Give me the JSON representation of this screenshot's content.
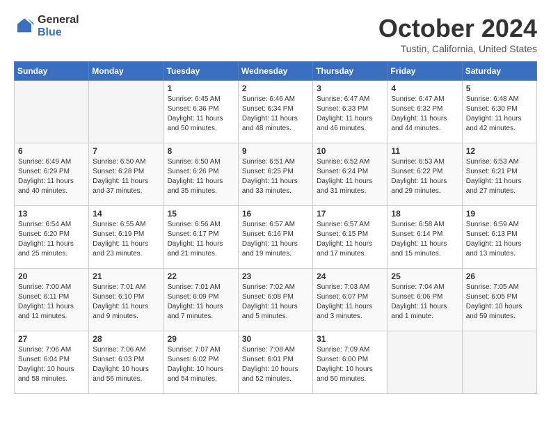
{
  "header": {
    "logo_line1": "General",
    "logo_line2": "Blue",
    "month_title": "October 2024",
    "location": "Tustin, California, United States"
  },
  "days_of_week": [
    "Sunday",
    "Monday",
    "Tuesday",
    "Wednesday",
    "Thursday",
    "Friday",
    "Saturday"
  ],
  "weeks": [
    [
      {
        "day": "",
        "sunrise": "",
        "sunset": "",
        "daylight": "",
        "empty": true
      },
      {
        "day": "",
        "sunrise": "",
        "sunset": "",
        "daylight": "",
        "empty": true
      },
      {
        "day": "1",
        "sunrise": "Sunrise: 6:45 AM",
        "sunset": "Sunset: 6:36 PM",
        "daylight": "Daylight: 11 hours and 50 minutes.",
        "empty": false
      },
      {
        "day": "2",
        "sunrise": "Sunrise: 6:46 AM",
        "sunset": "Sunset: 6:34 PM",
        "daylight": "Daylight: 11 hours and 48 minutes.",
        "empty": false
      },
      {
        "day": "3",
        "sunrise": "Sunrise: 6:47 AM",
        "sunset": "Sunset: 6:33 PM",
        "daylight": "Daylight: 11 hours and 46 minutes.",
        "empty": false
      },
      {
        "day": "4",
        "sunrise": "Sunrise: 6:47 AM",
        "sunset": "Sunset: 6:32 PM",
        "daylight": "Daylight: 11 hours and 44 minutes.",
        "empty": false
      },
      {
        "day": "5",
        "sunrise": "Sunrise: 6:48 AM",
        "sunset": "Sunset: 6:30 PM",
        "daylight": "Daylight: 11 hours and 42 minutes.",
        "empty": false
      }
    ],
    [
      {
        "day": "6",
        "sunrise": "Sunrise: 6:49 AM",
        "sunset": "Sunset: 6:29 PM",
        "daylight": "Daylight: 11 hours and 40 minutes.",
        "empty": false
      },
      {
        "day": "7",
        "sunrise": "Sunrise: 6:50 AM",
        "sunset": "Sunset: 6:28 PM",
        "daylight": "Daylight: 11 hours and 37 minutes.",
        "empty": false
      },
      {
        "day": "8",
        "sunrise": "Sunrise: 6:50 AM",
        "sunset": "Sunset: 6:26 PM",
        "daylight": "Daylight: 11 hours and 35 minutes.",
        "empty": false
      },
      {
        "day": "9",
        "sunrise": "Sunrise: 6:51 AM",
        "sunset": "Sunset: 6:25 PM",
        "daylight": "Daylight: 11 hours and 33 minutes.",
        "empty": false
      },
      {
        "day": "10",
        "sunrise": "Sunrise: 6:52 AM",
        "sunset": "Sunset: 6:24 PM",
        "daylight": "Daylight: 11 hours and 31 minutes.",
        "empty": false
      },
      {
        "day": "11",
        "sunrise": "Sunrise: 6:53 AM",
        "sunset": "Sunset: 6:22 PM",
        "daylight": "Daylight: 11 hours and 29 minutes.",
        "empty": false
      },
      {
        "day": "12",
        "sunrise": "Sunrise: 6:53 AM",
        "sunset": "Sunset: 6:21 PM",
        "daylight": "Daylight: 11 hours and 27 minutes.",
        "empty": false
      }
    ],
    [
      {
        "day": "13",
        "sunrise": "Sunrise: 6:54 AM",
        "sunset": "Sunset: 6:20 PM",
        "daylight": "Daylight: 11 hours and 25 minutes.",
        "empty": false
      },
      {
        "day": "14",
        "sunrise": "Sunrise: 6:55 AM",
        "sunset": "Sunset: 6:19 PM",
        "daylight": "Daylight: 11 hours and 23 minutes.",
        "empty": false
      },
      {
        "day": "15",
        "sunrise": "Sunrise: 6:56 AM",
        "sunset": "Sunset: 6:17 PM",
        "daylight": "Daylight: 11 hours and 21 minutes.",
        "empty": false
      },
      {
        "day": "16",
        "sunrise": "Sunrise: 6:57 AM",
        "sunset": "Sunset: 6:16 PM",
        "daylight": "Daylight: 11 hours and 19 minutes.",
        "empty": false
      },
      {
        "day": "17",
        "sunrise": "Sunrise: 6:57 AM",
        "sunset": "Sunset: 6:15 PM",
        "daylight": "Daylight: 11 hours and 17 minutes.",
        "empty": false
      },
      {
        "day": "18",
        "sunrise": "Sunrise: 6:58 AM",
        "sunset": "Sunset: 6:14 PM",
        "daylight": "Daylight: 11 hours and 15 minutes.",
        "empty": false
      },
      {
        "day": "19",
        "sunrise": "Sunrise: 6:59 AM",
        "sunset": "Sunset: 6:13 PM",
        "daylight": "Daylight: 11 hours and 13 minutes.",
        "empty": false
      }
    ],
    [
      {
        "day": "20",
        "sunrise": "Sunrise: 7:00 AM",
        "sunset": "Sunset: 6:11 PM",
        "daylight": "Daylight: 11 hours and 11 minutes.",
        "empty": false
      },
      {
        "day": "21",
        "sunrise": "Sunrise: 7:01 AM",
        "sunset": "Sunset: 6:10 PM",
        "daylight": "Daylight: 11 hours and 9 minutes.",
        "empty": false
      },
      {
        "day": "22",
        "sunrise": "Sunrise: 7:01 AM",
        "sunset": "Sunset: 6:09 PM",
        "daylight": "Daylight: 11 hours and 7 minutes.",
        "empty": false
      },
      {
        "day": "23",
        "sunrise": "Sunrise: 7:02 AM",
        "sunset": "Sunset: 6:08 PM",
        "daylight": "Daylight: 11 hours and 5 minutes.",
        "empty": false
      },
      {
        "day": "24",
        "sunrise": "Sunrise: 7:03 AM",
        "sunset": "Sunset: 6:07 PM",
        "daylight": "Daylight: 11 hours and 3 minutes.",
        "empty": false
      },
      {
        "day": "25",
        "sunrise": "Sunrise: 7:04 AM",
        "sunset": "Sunset: 6:06 PM",
        "daylight": "Daylight: 11 hours and 1 minute.",
        "empty": false
      },
      {
        "day": "26",
        "sunrise": "Sunrise: 7:05 AM",
        "sunset": "Sunset: 6:05 PM",
        "daylight": "Daylight: 10 hours and 59 minutes.",
        "empty": false
      }
    ],
    [
      {
        "day": "27",
        "sunrise": "Sunrise: 7:06 AM",
        "sunset": "Sunset: 6:04 PM",
        "daylight": "Daylight: 10 hours and 58 minutes.",
        "empty": false
      },
      {
        "day": "28",
        "sunrise": "Sunrise: 7:06 AM",
        "sunset": "Sunset: 6:03 PM",
        "daylight": "Daylight: 10 hours and 56 minutes.",
        "empty": false
      },
      {
        "day": "29",
        "sunrise": "Sunrise: 7:07 AM",
        "sunset": "Sunset: 6:02 PM",
        "daylight": "Daylight: 10 hours and 54 minutes.",
        "empty": false
      },
      {
        "day": "30",
        "sunrise": "Sunrise: 7:08 AM",
        "sunset": "Sunset: 6:01 PM",
        "daylight": "Daylight: 10 hours and 52 minutes.",
        "empty": false
      },
      {
        "day": "31",
        "sunrise": "Sunrise: 7:09 AM",
        "sunset": "Sunset: 6:00 PM",
        "daylight": "Daylight: 10 hours and 50 minutes.",
        "empty": false
      },
      {
        "day": "",
        "sunrise": "",
        "sunset": "",
        "daylight": "",
        "empty": true
      },
      {
        "day": "",
        "sunrise": "",
        "sunset": "",
        "daylight": "",
        "empty": true
      }
    ]
  ]
}
